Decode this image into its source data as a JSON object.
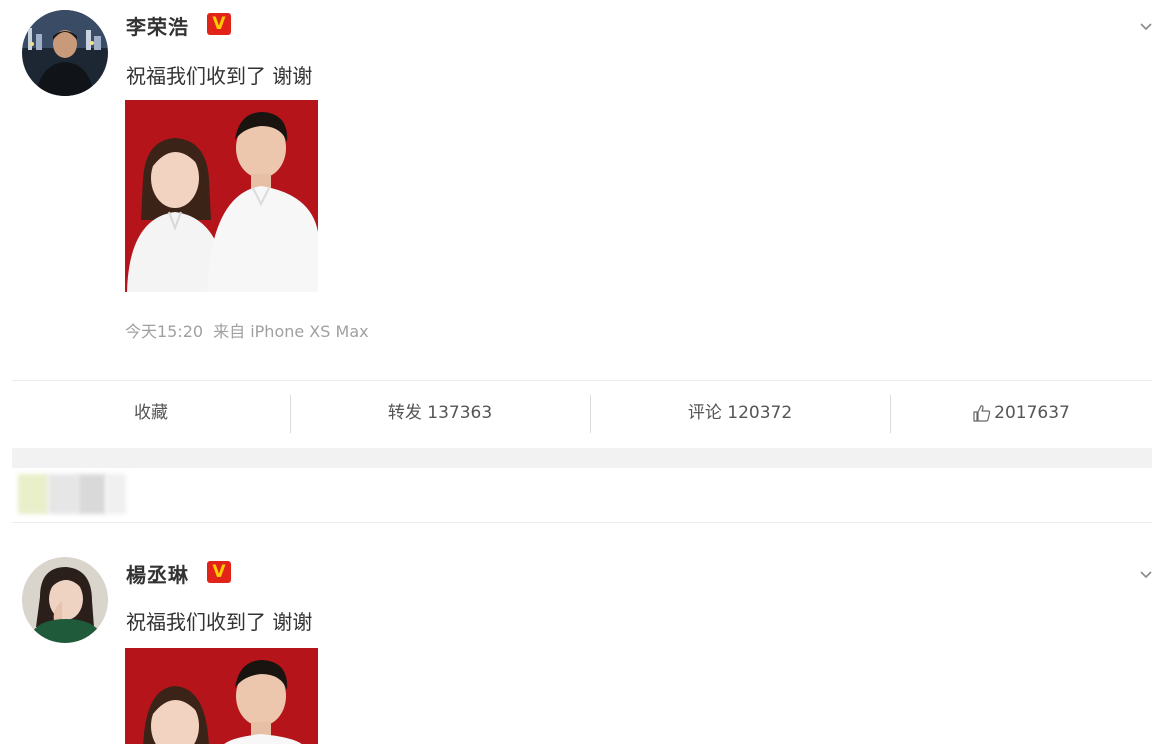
{
  "posts": [
    {
      "author": "李荣浩",
      "verified_badge": "V",
      "text": "祝福我们收到了 谢谢",
      "time": "今天15:20",
      "source": "来自 iPhone XS Max",
      "actions": {
        "favorite_label": "收藏",
        "repost_label": "转发 137363",
        "comment_label": "评论 120372",
        "like_count": "2017637"
      }
    },
    {
      "author": "楊丞琳",
      "verified_badge": "V",
      "text": "祝福我们收到了 谢谢"
    }
  ],
  "colors": {
    "badge_red": "#e2231a",
    "badge_yellow": "#ffcc00",
    "photo_background": "#b5141b",
    "meta_gray": "#a0a0a0"
  },
  "icons": [
    "chevron-down-icon",
    "thumbs-up-icon",
    "verified-badge-icon"
  ]
}
